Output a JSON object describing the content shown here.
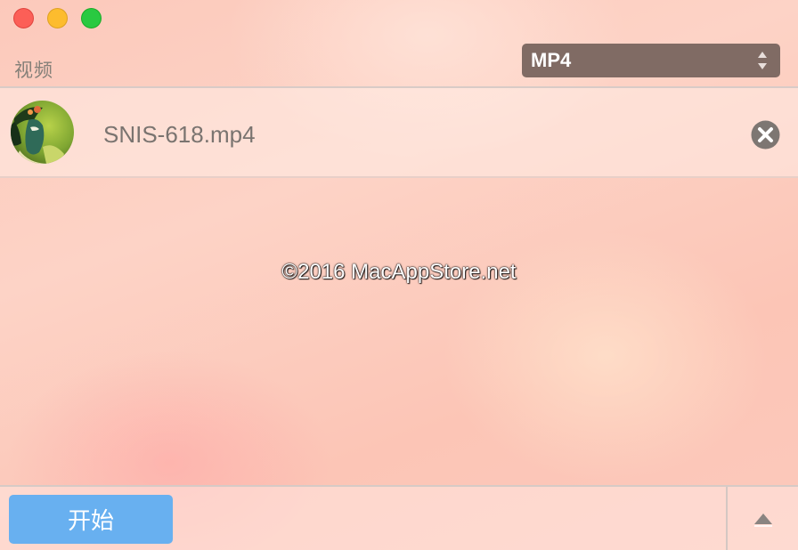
{
  "window": {
    "controls": [
      "close",
      "minimize",
      "zoom"
    ]
  },
  "section": {
    "label": "视频"
  },
  "format_select": {
    "value": "MP4"
  },
  "files": [
    {
      "name": "SNIS-618.mp4",
      "thumbnail": "anime-character-thumbnail"
    }
  ],
  "watermark": "©2016 MacAppStore.net",
  "footer": {
    "start_label": "开始",
    "expand_icon": "triangle-up-icon"
  },
  "colors": {
    "start_button": "#68b0f0",
    "select_background": "#806b64",
    "close": "#fc5f57",
    "minimize": "#fdbc2e",
    "zoom": "#29c941"
  }
}
